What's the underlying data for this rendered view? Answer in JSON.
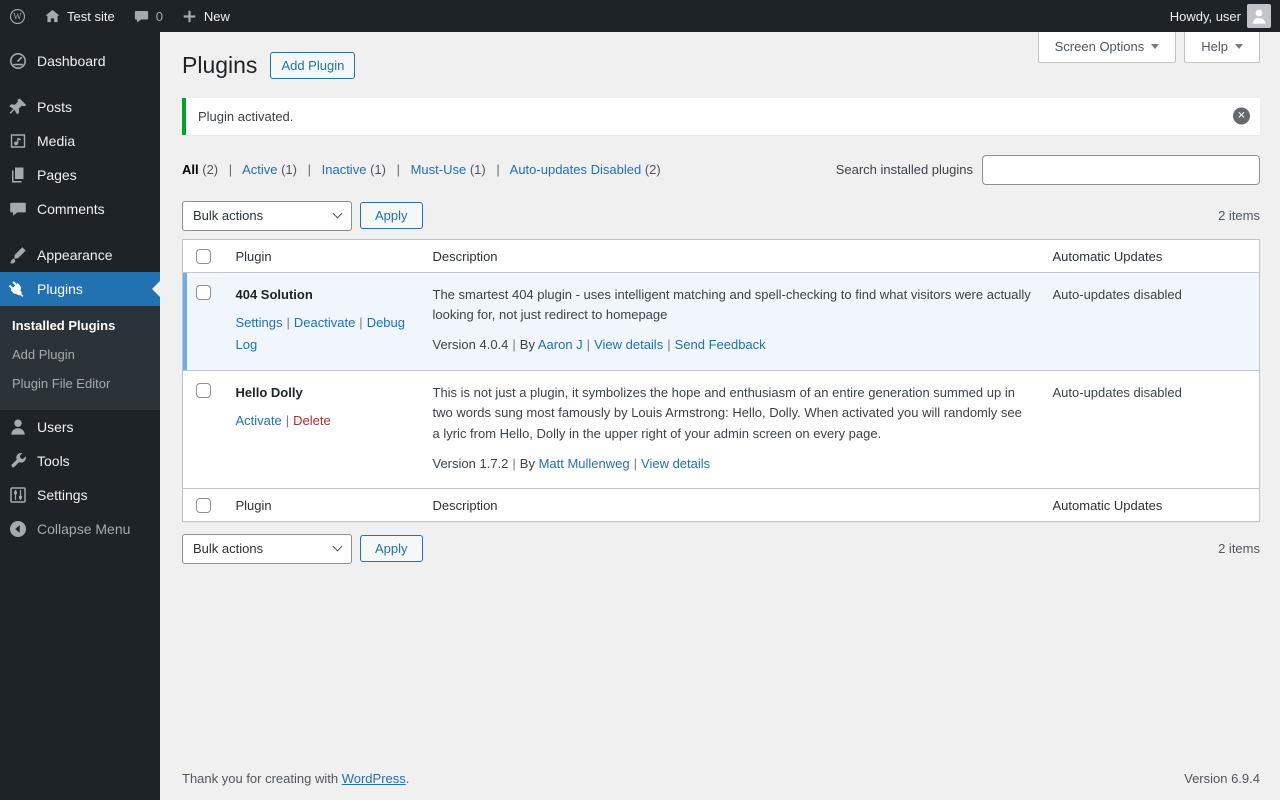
{
  "sep": "|",
  "admin_bar": {
    "site_name": "Test site",
    "comments_count": "0",
    "new_label": "New",
    "howdy_text": "Howdy, user"
  },
  "screen_meta": {
    "screen_options_label": "Screen Options",
    "help_label": "Help"
  },
  "page": {
    "title": "Plugins",
    "add_plugin_label": "Add Plugin"
  },
  "notice": {
    "message": "Plugin activated.",
    "dismiss_icon": "✕"
  },
  "filters": {
    "all": {
      "label": "All",
      "count": "(2)"
    },
    "active": {
      "label": "Active",
      "count": "(1)"
    },
    "inactive": {
      "label": "Inactive",
      "count": "(1)"
    },
    "must_use": {
      "label": "Must-Use",
      "count": "(1)"
    },
    "auto_disabled": {
      "label": "Auto-updates Disabled",
      "count": "(2)"
    }
  },
  "search": {
    "label": "Search installed plugins",
    "value": ""
  },
  "tablenav": {
    "bulk_actions_label": "Bulk actions",
    "apply_label": "Apply",
    "items_count": "2 items"
  },
  "table": {
    "columns": {
      "plugin": "Plugin",
      "description": "Description",
      "auto_updates": "Automatic Updates"
    },
    "rows": [
      {
        "name": "404 Solution",
        "action_1": "Settings",
        "action_2": "Deactivate",
        "action_3": "Debug Log",
        "description": "The smartest 404 plugin - uses intelligent matching and spell-checking to find what visitors were actually looking for, not just redirect to homepage",
        "version": "Version 4.0.4",
        "by_label": "By",
        "author": "Aaron J",
        "link_1": "View details",
        "link_2": "Send Feedback",
        "auto_updates": "Auto-updates disabled"
      },
      {
        "name": "Hello Dolly",
        "action_1": "Activate",
        "action_2": "Delete",
        "description": "This is not just a plugin, it symbolizes the hope and enthusiasm of an entire generation summed up in two words sung most famously by Louis Armstrong: Hello, Dolly. When activated you will randomly see a lyric from Hello, Dolly in the upper right of your admin screen on every page.",
        "version": "Version 1.7.2",
        "by_label": "By",
        "author": "Matt Mullenweg",
        "link_1": "View details",
        "auto_updates": "Auto-updates disabled"
      }
    ]
  },
  "sidebar": {
    "dashboard": "Dashboard",
    "posts": "Posts",
    "media": "Media",
    "pages": "Pages",
    "comments": "Comments",
    "appearance": "Appearance",
    "plugins": "Plugins",
    "submenu": {
      "installed": "Installed Plugins",
      "add": "Add Plugin",
      "editor": "Plugin File Editor"
    },
    "users": "Users",
    "tools": "Tools",
    "settings": "Settings",
    "collapse": "Collapse Menu",
    "icons": [
      "wordpress-logo",
      "dashboard-icon",
      "pin-icon",
      "media-icon",
      "pages-icon",
      "comments-icon",
      "appearance-icon",
      "plugin-icon",
      "users-icon",
      "tools-icon",
      "settings-icon",
      "collapse-icon"
    ]
  },
  "footer": {
    "thanks_prefix": "Thank you for creating with",
    "wordpress_link": "WordPress",
    "suffix": ".",
    "version": "Version 6.9.4"
  },
  "colors": {
    "accent_blue": "#2271b1",
    "admin_dark": "#1d2327",
    "submenu_dark": "#2c3338",
    "active_row_bg": "#f0f6fc",
    "active_row_border": "#72aee6",
    "notice_green": "#00a32a",
    "danger_red": "#b32d2e",
    "content_bg": "#f0f0f1"
  }
}
